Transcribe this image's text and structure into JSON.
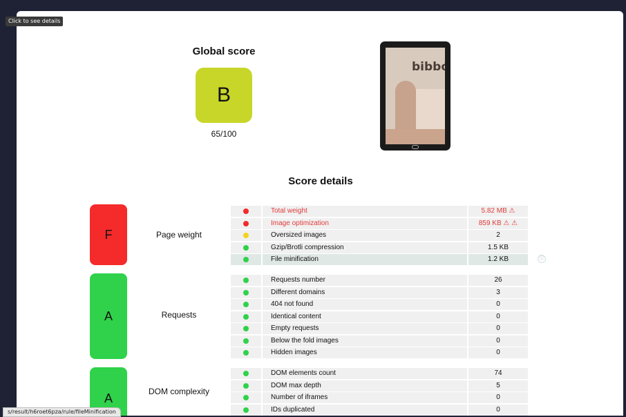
{
  "tooltip": "Click to see details",
  "status_url": "s/result/h6roet6pza/rule/fileMinification",
  "global": {
    "title": "Global score",
    "grade": "B",
    "value": "65/100"
  },
  "device": {
    "brand": "bibbó."
  },
  "details_title": "Score details",
  "colors": {
    "red": "#f52a2a",
    "yellow": "#f2d31b",
    "green": "#2fd24a",
    "grade_b": "#c8d62a"
  },
  "categories": [
    {
      "label": "Page weight",
      "grade": "F",
      "color": "red",
      "rules": [
        {
          "name": "Total weight",
          "value": "5.82 MB ⚠",
          "status": "red",
          "warn": true
        },
        {
          "name": "Image optimization",
          "value": "859 KB ⚠ ⚠",
          "status": "red",
          "warn": true
        },
        {
          "name": "Oversized images",
          "value": "2",
          "status": "yellow"
        },
        {
          "name": "Gzip/Brotli compression",
          "value": "1.5 KB",
          "status": "green"
        },
        {
          "name": "File minification",
          "value": "1.2 KB",
          "status": "green",
          "hover": true
        }
      ]
    },
    {
      "label": "Requests",
      "grade": "A",
      "color": "green",
      "rules": [
        {
          "name": "Requests number",
          "value": "26",
          "status": "green"
        },
        {
          "name": "Different domains",
          "value": "3",
          "status": "green"
        },
        {
          "name": "404 not found",
          "value": "0",
          "status": "green"
        },
        {
          "name": "Identical content",
          "value": "0",
          "status": "green"
        },
        {
          "name": "Empty requests",
          "value": "0",
          "status": "green"
        },
        {
          "name": "Below the fold images",
          "value": "0",
          "status": "green"
        },
        {
          "name": "Hidden images",
          "value": "0",
          "status": "green"
        }
      ]
    },
    {
      "label": "DOM complexity",
      "grade": "A",
      "color": "green",
      "rules": [
        {
          "name": "DOM elements count",
          "value": "74",
          "status": "green"
        },
        {
          "name": "DOM max depth",
          "value": "5",
          "status": "green"
        },
        {
          "name": "Number of iframes",
          "value": "0",
          "status": "green"
        },
        {
          "name": "IDs duplicated",
          "value": "0",
          "status": "green"
        }
      ]
    }
  ]
}
